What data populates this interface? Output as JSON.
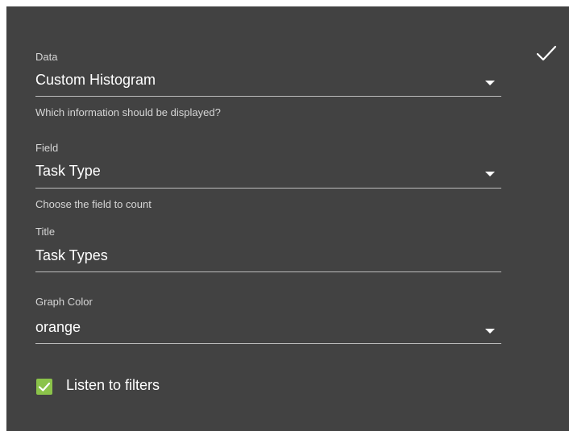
{
  "form": {
    "confirm_icon": "checkmark-icon",
    "data": {
      "label": "Data",
      "value": "Custom Histogram",
      "hint": "Which information should be displayed?"
    },
    "field": {
      "label": "Field",
      "value": "Task Type",
      "hint": "Choose the field to count"
    },
    "title": {
      "label": "Title",
      "value": "Task Types"
    },
    "graph_color": {
      "label": "Graph Color",
      "value": "orange"
    },
    "listen_to_filters": {
      "label": "Listen to filters",
      "checked": true
    }
  },
  "colors": {
    "panel_background": "#424242",
    "checkbox_accent": "#8bc34a",
    "text": "#ffffff",
    "secondary_text": "#d6d6d6"
  }
}
